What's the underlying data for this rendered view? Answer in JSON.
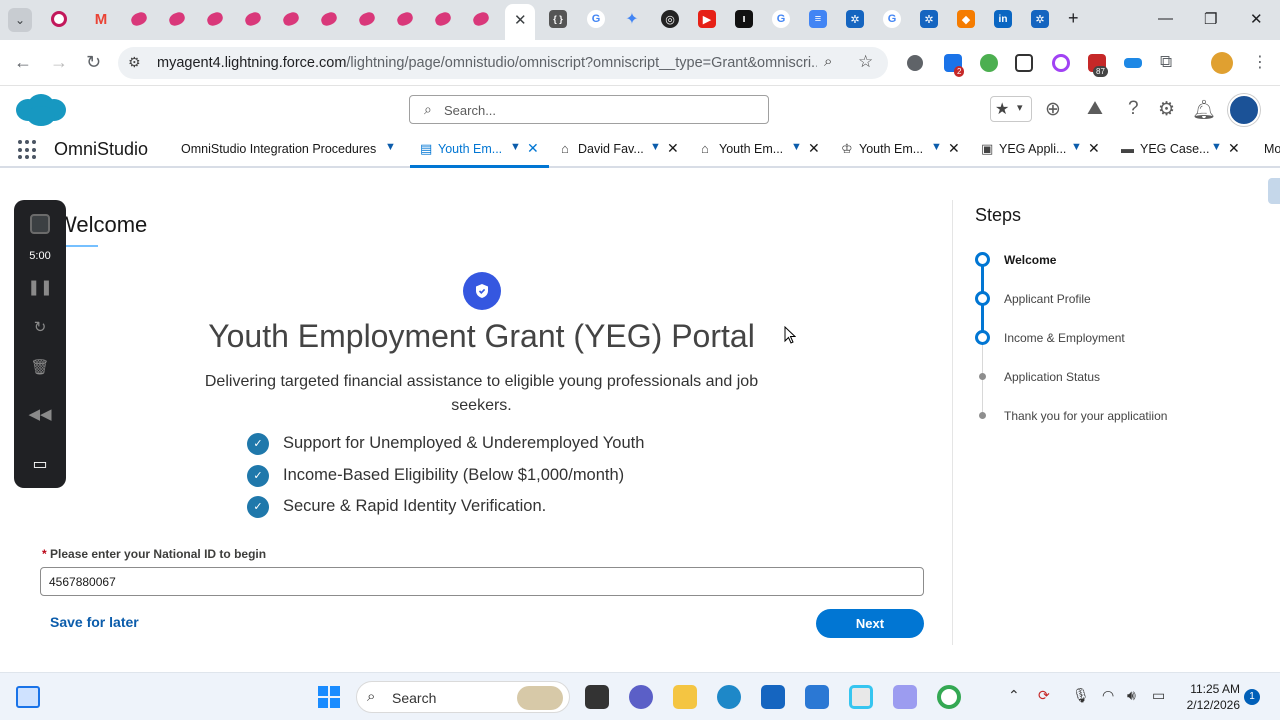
{
  "browser": {
    "active_tab_glyph": "✕",
    "address_url_host": "myagent4.lightning.force.com",
    "address_url_path": "/lightning/page/omnistudio/omniscript?omniscript__type=Grant&omniscri...",
    "extension_badge_1": "2",
    "extension_badge_2": "87",
    "icons": [
      "back-icon",
      "forward-icon",
      "reload-icon",
      "site-info-icon",
      "zoom-icon",
      "bookmark-star-icon",
      "extensions-icon",
      "profile-icon",
      "menu-icon"
    ]
  },
  "salesforce": {
    "search_placeholder": "Search...",
    "app_name": "OmniStudio",
    "workspace_tabs": [
      {
        "label": "OmniStudio Integration Procedures"
      },
      {
        "label": "Youth Em..."
      },
      {
        "label": "David Fav..."
      },
      {
        "label": "Youth Em..."
      },
      {
        "label": "Youth Em..."
      },
      {
        "label": "YEG Appli..."
      },
      {
        "label": "YEG Case..."
      },
      {
        "label": "Mo"
      }
    ]
  },
  "omniscript": {
    "step_heading": "Welcome",
    "portal_title": "Youth Employment Grant (YEG) Portal",
    "portal_subtitle": "Delivering targeted financial assistance to eligible young professionals and job seekers.",
    "features": [
      "Support for Unemployed & Underemployed Youth",
      "Income-Based Eligibility (Below $1,000/month)",
      "Secure & Rapid Identity Verification."
    ],
    "national_id_required": "*",
    "national_id_label": "Please enter your National ID to begin",
    "national_id_value": "4567880067",
    "save_for_later": "Save for later",
    "next": "Next"
  },
  "steps": {
    "title": "Steps",
    "items": [
      {
        "label": "Welcome",
        "state": "current"
      },
      {
        "label": "Applicant Profile",
        "state": "complete"
      },
      {
        "label": "Income & Employment",
        "state": "complete"
      },
      {
        "label": "Application Status",
        "state": "pending"
      },
      {
        "label": "Thank you for your applicatiion",
        "state": "pending"
      }
    ]
  },
  "recorder": {
    "time": "5:00"
  },
  "taskbar": {
    "search_label": "Search",
    "time": "11:25 AM",
    "date": "2/12/2026",
    "notification_count": "1"
  },
  "colors": {
    "salesforce_blue": "#0176d3",
    "shield_blue": "#3557e0",
    "check_blue": "#1f78ab"
  }
}
